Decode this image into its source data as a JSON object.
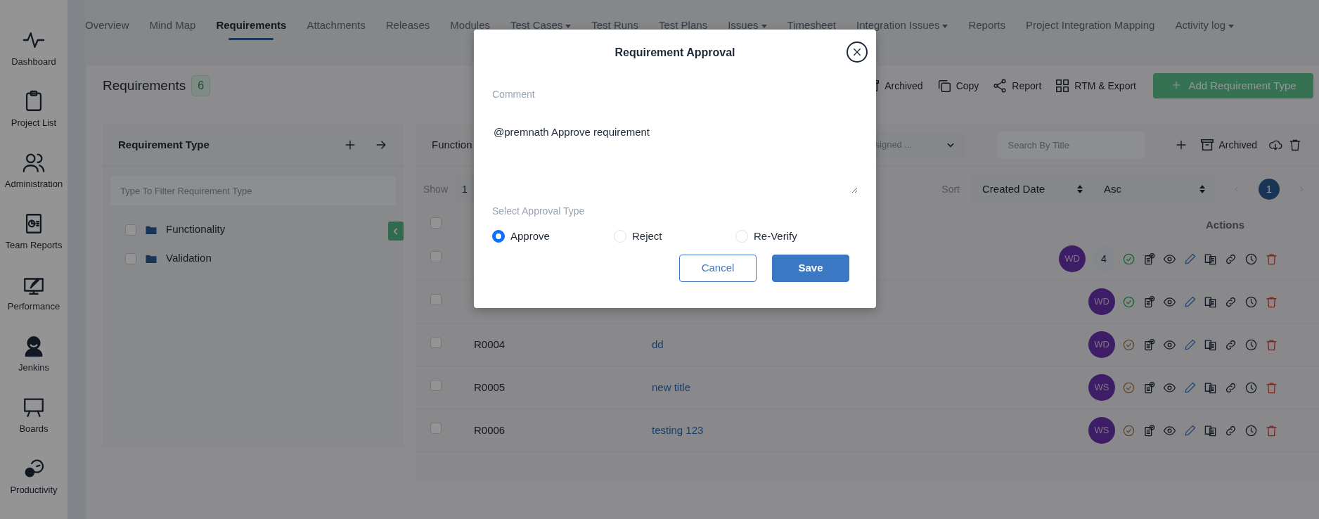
{
  "sidebar": {
    "items": [
      {
        "label": "Dashboard"
      },
      {
        "label": "Project List"
      },
      {
        "label": "Administration"
      },
      {
        "label": "Team Reports"
      },
      {
        "label": "Performance"
      },
      {
        "label": "Jenkins"
      },
      {
        "label": "Boards"
      },
      {
        "label": "Productivity"
      }
    ]
  },
  "nav_tabs": [
    {
      "label": "Overview",
      "selected": false,
      "dropdown": false
    },
    {
      "label": "Mind Map",
      "selected": false,
      "dropdown": false
    },
    {
      "label": "Requirements",
      "selected": true,
      "dropdown": false
    },
    {
      "label": "Attachments",
      "selected": false,
      "dropdown": false
    },
    {
      "label": "Releases",
      "selected": false,
      "dropdown": false
    },
    {
      "label": "Modules",
      "selected": false,
      "dropdown": false
    },
    {
      "label": "Test Cases",
      "selected": false,
      "dropdown": true
    },
    {
      "label": "Test Runs",
      "selected": false,
      "dropdown": false
    },
    {
      "label": "Test Plans",
      "selected": false,
      "dropdown": false
    },
    {
      "label": "Issues",
      "selected": false,
      "dropdown": true
    },
    {
      "label": "Timesheet",
      "selected": false,
      "dropdown": false
    },
    {
      "label": "Integration Issues",
      "selected": false,
      "dropdown": true
    },
    {
      "label": "Reports",
      "selected": false,
      "dropdown": false
    },
    {
      "label": "Project Integration Mapping",
      "selected": false,
      "dropdown": false
    },
    {
      "label": "Activity log",
      "selected": false,
      "dropdown": true
    }
  ],
  "page_header": {
    "title": "Requirements",
    "count": "6",
    "actions": [
      "Archived",
      "Copy",
      "Report",
      "RTM & Export"
    ],
    "add_button": "Add Requirement Type"
  },
  "requirement_type_panel": {
    "title": "Requirement Type",
    "filter_placeholder": "Type To Filter Requirement Type",
    "items": [
      {
        "label": "Functionality",
        "checked": false
      },
      {
        "label": "Validation",
        "checked": false
      }
    ]
  },
  "requirements_panel": {
    "tab_label": "Function",
    "assignee_select": "signed ...",
    "search_placeholder": "Search By Title",
    "archived_label": "Archived",
    "show_label": "Show",
    "show_value": "1",
    "sort_label": "Sort",
    "sort_field": "Created Date",
    "sort_order": "Asc",
    "page": "1",
    "select_all_checked": false,
    "columns": [
      "Actions"
    ],
    "rows": [
      {
        "checked": false,
        "avatar": "WD",
        "comment_count": "4",
        "approved": true
      },
      {
        "checked": false,
        "avatar": "WD",
        "approved": true
      },
      {
        "checked": false,
        "id": "R0004",
        "title": "dd",
        "avatar": "WD",
        "approved": false
      },
      {
        "checked": false,
        "id": "R0005",
        "title": "new title",
        "avatar": "WS",
        "approved": false
      },
      {
        "checked": false,
        "id": "R0006",
        "title": "testing 123",
        "avatar": "WS",
        "approved": false
      }
    ]
  },
  "modal": {
    "title": "Requirement Approval",
    "comment_label": "Comment",
    "comment_value": "@premnath Approve requirement",
    "approval_label": "Select Approval Type",
    "options": [
      {
        "label": "Approve",
        "selected": true
      },
      {
        "label": "Reject",
        "selected": false
      },
      {
        "label": "Re-Verify",
        "selected": false
      }
    ],
    "buttons": [
      {
        "label": "Cancel",
        "kind": "secondary"
      },
      {
        "label": "Save",
        "kind": "primary"
      }
    ]
  }
}
